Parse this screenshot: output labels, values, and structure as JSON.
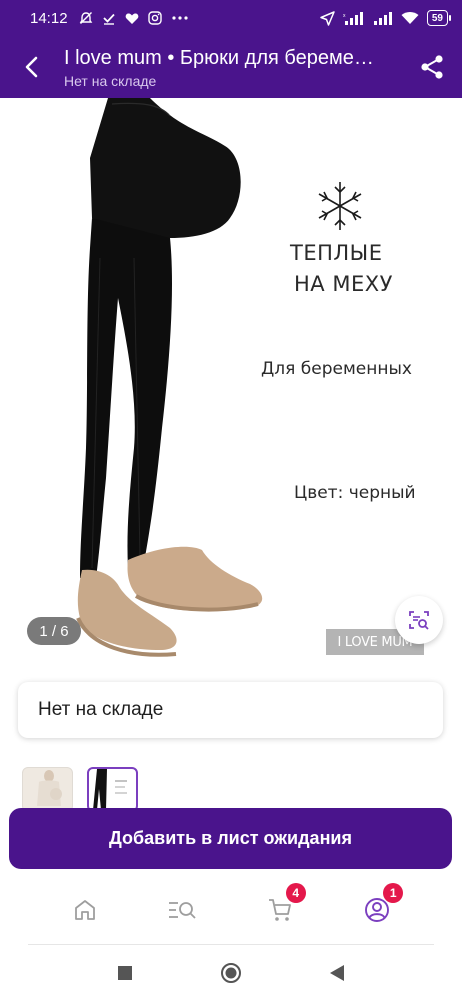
{
  "status_bar": {
    "time": "14:12",
    "battery": "59",
    "icons": [
      "muted-alarm-icon",
      "check-icon",
      "heart-icon",
      "instagram-icon",
      "more-dots-icon",
      "location-arrow-icon",
      "signal-icon",
      "signal-icon",
      "wifi-icon",
      "battery-icon"
    ]
  },
  "header": {
    "title": "I love mum • Брюки для беременных",
    "subtitle": "Нет на складе",
    "back_icon": "back-arrow-icon",
    "share_icon": "share-icon"
  },
  "product_image": {
    "warm_line1": "ТЕПЛЫЕ",
    "warm_line2": "НА МЕХУ",
    "pregnant_label": "Для беременных",
    "color_label": "Цвет: черный",
    "brand_badge": "I LOVE MUM",
    "counter": "1 / 6",
    "visual_search_icon": "visual-search-icon"
  },
  "stock_card": {
    "text": "Нет на складе"
  },
  "thumbnails": [
    {
      "selected": false
    },
    {
      "selected": true
    }
  ],
  "cta": {
    "label": "Добавить в лист ожидания"
  },
  "bottom_nav": {
    "items": [
      {
        "icon": "home-icon",
        "badge": ""
      },
      {
        "icon": "catalog-search-icon",
        "badge": ""
      },
      {
        "icon": "cart-icon",
        "badge": "4"
      },
      {
        "icon": "profile-icon",
        "badge": "1"
      }
    ]
  },
  "colors": {
    "brand": "#4a148c",
    "badge": "#e4184b",
    "accent": "#7b3fbf"
  }
}
